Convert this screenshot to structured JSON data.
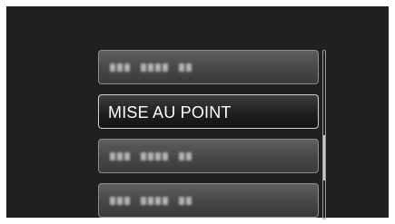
{
  "menu": {
    "items": [
      {
        "label": "",
        "state": "blurred"
      },
      {
        "label": "MISE AU POINT",
        "state": "selected"
      },
      {
        "label": "",
        "state": "blurred"
      },
      {
        "label": "",
        "state": "blurred"
      }
    ]
  },
  "scrollbar": {
    "position": "middle"
  }
}
